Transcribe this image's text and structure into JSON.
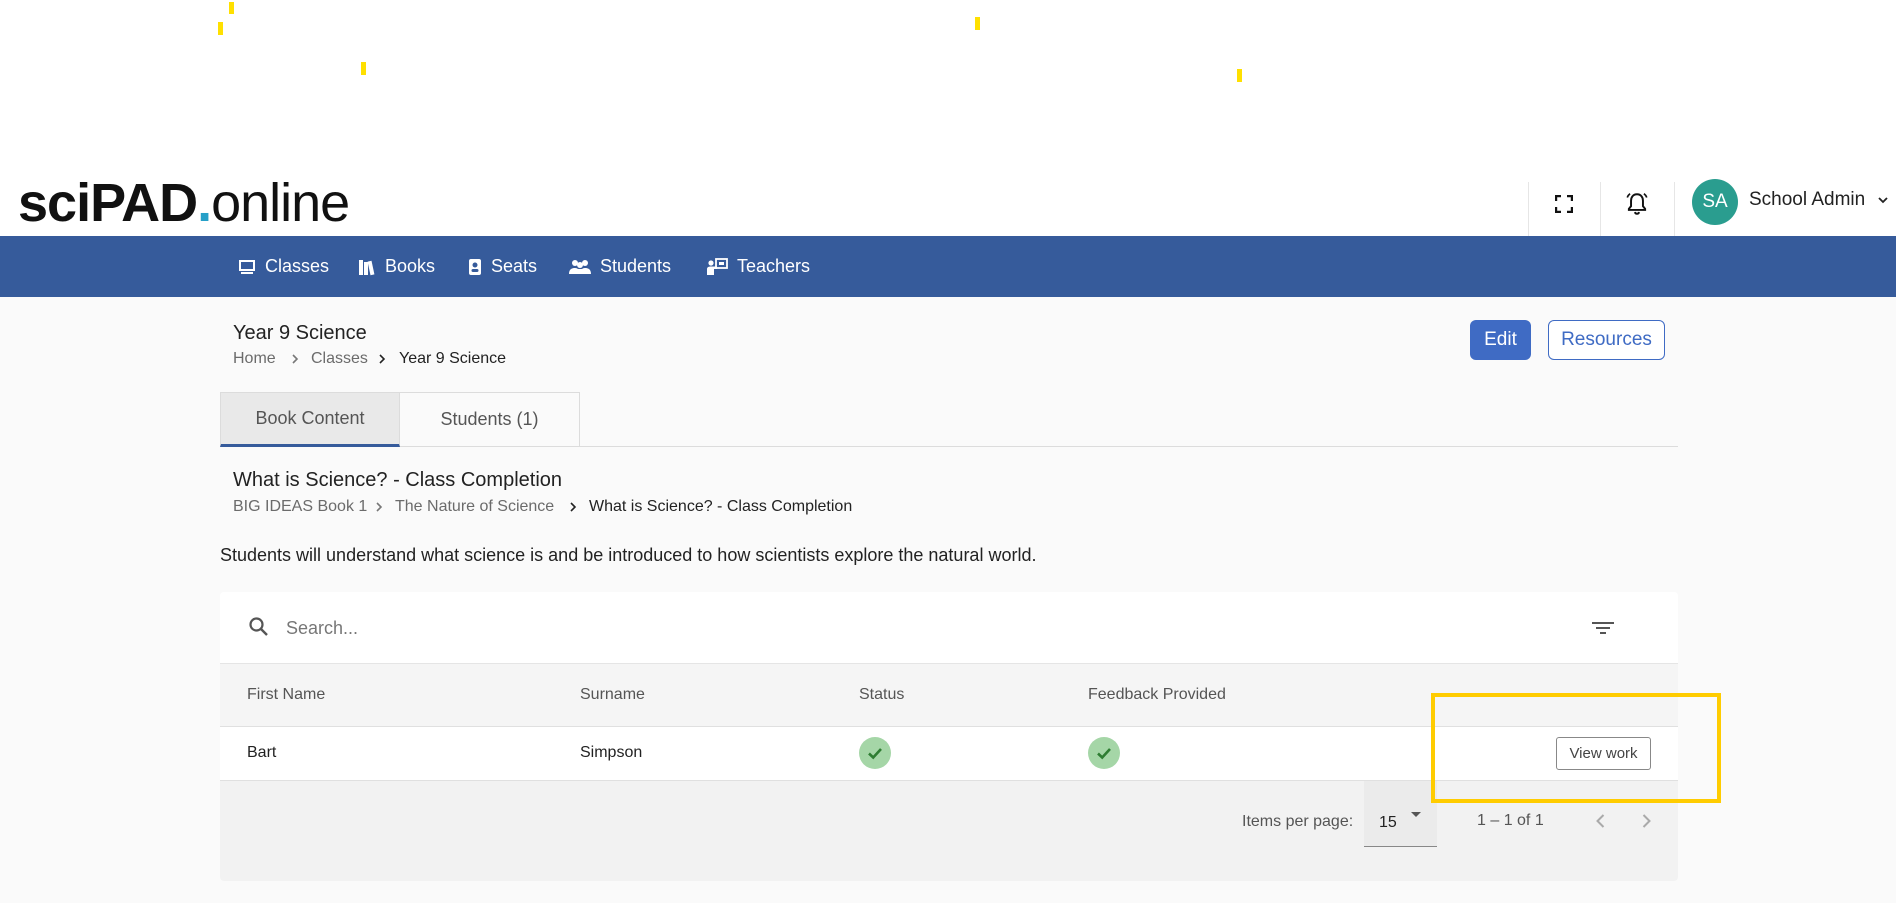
{
  "brand": {
    "logo_bold": "sciPAD",
    "logo_dot": ".",
    "logo_light": "online"
  },
  "header": {
    "fullscreen_icon": "fullscreen-icon",
    "notification_icon": "bell-icon",
    "user_initials": "SA",
    "user_name": "School Admin",
    "avatar_color": "#2a9d8f"
  },
  "nav": {
    "items": [
      {
        "label": "Classes",
        "icon": "class-board-icon"
      },
      {
        "label": "Books",
        "icon": "books-icon"
      },
      {
        "label": "Seats",
        "icon": "badge-icon"
      },
      {
        "label": "Students",
        "icon": "people-icon"
      },
      {
        "label": "Teachers",
        "icon": "teacher-icon"
      }
    ],
    "bar_color": "#365b9b"
  },
  "page": {
    "title": "Year 9 Science",
    "breadcrumb": [
      "Home",
      "Classes",
      "Year 9 Science"
    ],
    "edit_label": "Edit",
    "resources_label": "Resources"
  },
  "tabs": [
    {
      "label": "Book Content",
      "active": true
    },
    {
      "label": "Students (1)",
      "active": false
    }
  ],
  "section": {
    "title": "What is Science? - Class Completion",
    "breadcrumb": [
      "BIG IDEAS Book 1",
      "The Nature of Science",
      "What is Science? - Class Completion"
    ],
    "description": "Students will understand what science is and be introduced to how scientists explore the natural world."
  },
  "table": {
    "search_placeholder": "Search...",
    "columns": [
      "First Name",
      "Surname",
      "Status",
      "Feedback Provided"
    ],
    "rows": [
      {
        "first_name": "Bart",
        "surname": "Simpson",
        "status": "complete",
        "feedback": "provided",
        "action": "View work"
      }
    ]
  },
  "pagination": {
    "items_per_page_label": "Items per page:",
    "items_per_page": "15",
    "range": "1 – 1 of 1"
  },
  "colors": {
    "primary": "#3f6bc4",
    "success": "#a5d6a7",
    "highlight": "#ffcc00"
  }
}
